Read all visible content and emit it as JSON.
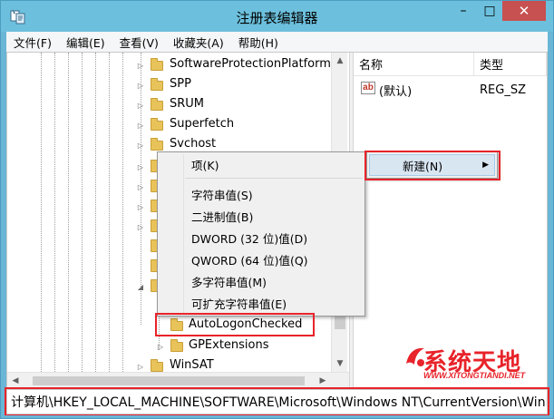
{
  "window": {
    "title": "注册表编辑器",
    "minimize": "–",
    "maximize": "□",
    "close": "✕"
  },
  "menu": [
    "文件(F)",
    "编辑(E)",
    "查看(V)",
    "收藏夹(A)",
    "帮助(H)"
  ],
  "tree": {
    "nodes": [
      {
        "label": "SoftwareProtectionPlatform"
      },
      {
        "label": "SPP"
      },
      {
        "label": "SRUM"
      },
      {
        "label": "Superfetch"
      },
      {
        "label": "Svchost"
      },
      {
        "label": "AutoLogonChecked"
      },
      {
        "label": "GPExtensions"
      },
      {
        "label": "WinSAT"
      }
    ]
  },
  "list": {
    "columns": [
      "名称",
      "类型"
    ],
    "rows": [
      {
        "name": "(默认)",
        "type": "REG_SZ",
        "icon": "ab-string-icon"
      }
    ]
  },
  "context_menu": {
    "items": [
      "项(K)",
      "字符串值(S)",
      "二进制值(B)",
      "DWORD (32 位)值(D)",
      "QWORD (64 位)值(Q)",
      "多字符串值(M)",
      "可扩充字符串值(E)"
    ]
  },
  "parent_menu": {
    "new_label": "新建(N)"
  },
  "status": {
    "path": "计算机\\HKEY_LOCAL_MACHINE\\SOFTWARE\\Microsoft\\Windows NT\\CurrentVersion\\Winlogon"
  },
  "watermark": {
    "title": "系统天地",
    "subtitle": "WWW.XITONGTIANDI.NET"
  },
  "colors": {
    "highlight": "#e8232a",
    "titlebar": "#6cc0dd",
    "close": "#c75050"
  }
}
